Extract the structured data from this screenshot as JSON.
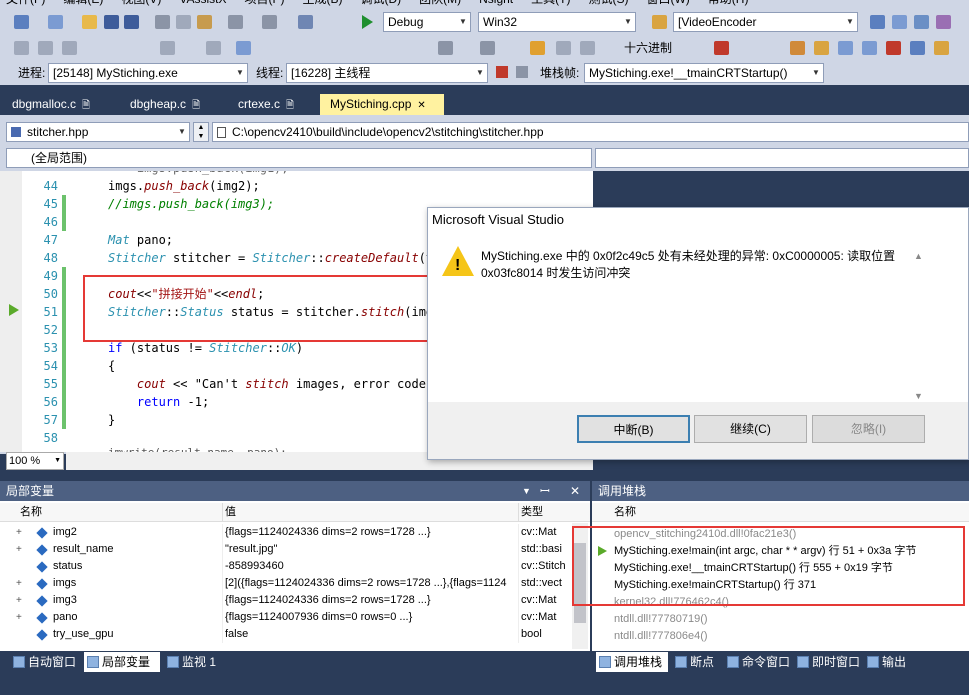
{
  "menu": {
    "items": [
      "文件(F)",
      "编辑(E)",
      "视图(V)",
      "VAssistX",
      "项目(P)",
      "生成(B)",
      "调试(D)",
      "团队(M)",
      "Nsight",
      "工具(T)",
      "测试(S)",
      "窗口(W)",
      "帮助(H)"
    ]
  },
  "toolbar": {
    "config": "Debug",
    "platform": "Win32",
    "find_target": "[VideoEncoder",
    "hex_label": "十六进制"
  },
  "debugbar": {
    "process_label": "进程:",
    "process_value": "[25148] MyStiching.exe",
    "thread_label": "线程:",
    "thread_value": "[16228] 主线程",
    "stack_label": "堆栈帧:",
    "stack_value": "MyStiching.exe!__tmainCRTStartup()"
  },
  "tabs": [
    {
      "label": "dbgmalloc.c"
    },
    {
      "label": "dbgheap.c"
    },
    {
      "label": "crtexe.c"
    },
    {
      "label": "MyStiching.cpp"
    }
  ],
  "navbar": {
    "file_combo": "stitcher.hpp",
    "path": "C:\\opencv2410\\build\\include\\opencv2\\stitching\\stitcher.hpp",
    "scope": "(全局范围)"
  },
  "code": {
    "lines": [
      {
        "num": "44",
        "text": "imgs.push_back(img2);"
      },
      {
        "num": "45",
        "text": "//imgs.push_back(img3);"
      },
      {
        "num": "46",
        "text": ""
      },
      {
        "num": "47",
        "text": "Mat pano;"
      },
      {
        "num": "48",
        "text": "Stitcher stitcher = Stitcher::createDefault(tr"
      },
      {
        "num": "49",
        "text": ""
      },
      {
        "num": "50",
        "text": "cout<<\"拼接开始\"<<endl;"
      },
      {
        "num": "51",
        "text": "Stitcher::Status status = stitcher.stitch(imgs"
      },
      {
        "num": "52",
        "text": ""
      },
      {
        "num": "53",
        "text": "if (status != Stitcher::OK)"
      },
      {
        "num": "54",
        "text": "{"
      },
      {
        "num": "55",
        "text": "    cout << \"Can't stitch images, error code ="
      },
      {
        "num": "56",
        "text": "    return -1;"
      },
      {
        "num": "57",
        "text": "}"
      },
      {
        "num": "58",
        "text": ""
      }
    ],
    "zoom": "100 %"
  },
  "dialog": {
    "title": "Microsoft Visual Studio",
    "message": "MyStiching.exe 中的 0x0f2c49c5 处有未经处理的异常: 0xC0000005: 读取位置 0x03fc8014 时发生访问冲突",
    "break_button": "中断(B)",
    "continue_button": "继续(C)",
    "ignore_button": "忽略(I)"
  },
  "locals": {
    "title": "局部变量",
    "columns": [
      "名称",
      "值",
      "类型"
    ],
    "rows": [
      {
        "name": "img2",
        "value": "{flags=1124024336 dims=2 rows=1728 ...}",
        "type": "cv::Mat",
        "expand": "+"
      },
      {
        "name": "result_name",
        "value": "\"result.jpg\"",
        "type": "std::basi",
        "expand": "+"
      },
      {
        "name": "status",
        "value": "-858993460",
        "type": "cv::Stitch",
        "expand": ""
      },
      {
        "name": "imgs",
        "value": "[2]({flags=1124024336 dims=2 rows=1728 ...},{flags=1124",
        "type": "std::vect",
        "expand": "+"
      },
      {
        "name": "img3",
        "value": "{flags=1124024336 dims=2 rows=1728 ...}",
        "type": "cv::Mat",
        "expand": "+"
      },
      {
        "name": "pano",
        "value": "{flags=1124007936 dims=0 rows=0 ...}",
        "type": "cv::Mat",
        "expand": "+"
      },
      {
        "name": "try_use_gpu",
        "value": "false",
        "type": "bool",
        "expand": ""
      }
    ]
  },
  "callstack": {
    "title": "调用堆栈",
    "column": "名称",
    "rows": [
      {
        "text": "opencv_stitching2410d.dll!0fac21e3()",
        "grey": true
      },
      {
        "text": "MyStiching.exe!main(int argc, char * * argv)  行 51 + 0x3a 字节",
        "grey": false
      },
      {
        "text": "MyStiching.exe!__tmainCRTStartup()  行 555 + 0x19 字节",
        "grey": false
      },
      {
        "text": "MyStiching.exe!mainCRTStartup()  行 371",
        "grey": false
      },
      {
        "text": "kernel32.dll!776462c4()",
        "grey": true
      },
      {
        "text": "ntdll.dll!77780719()",
        "grey": true
      },
      {
        "text": "ntdll.dll!777806e4()",
        "grey": true
      }
    ]
  },
  "bottom_tabs_left": [
    "自动窗口",
    "局部变量",
    "监视 1"
  ],
  "bottom_tabs_right": [
    "调用堆栈",
    "断点",
    "命令窗口",
    "即时窗口",
    "输出"
  ]
}
